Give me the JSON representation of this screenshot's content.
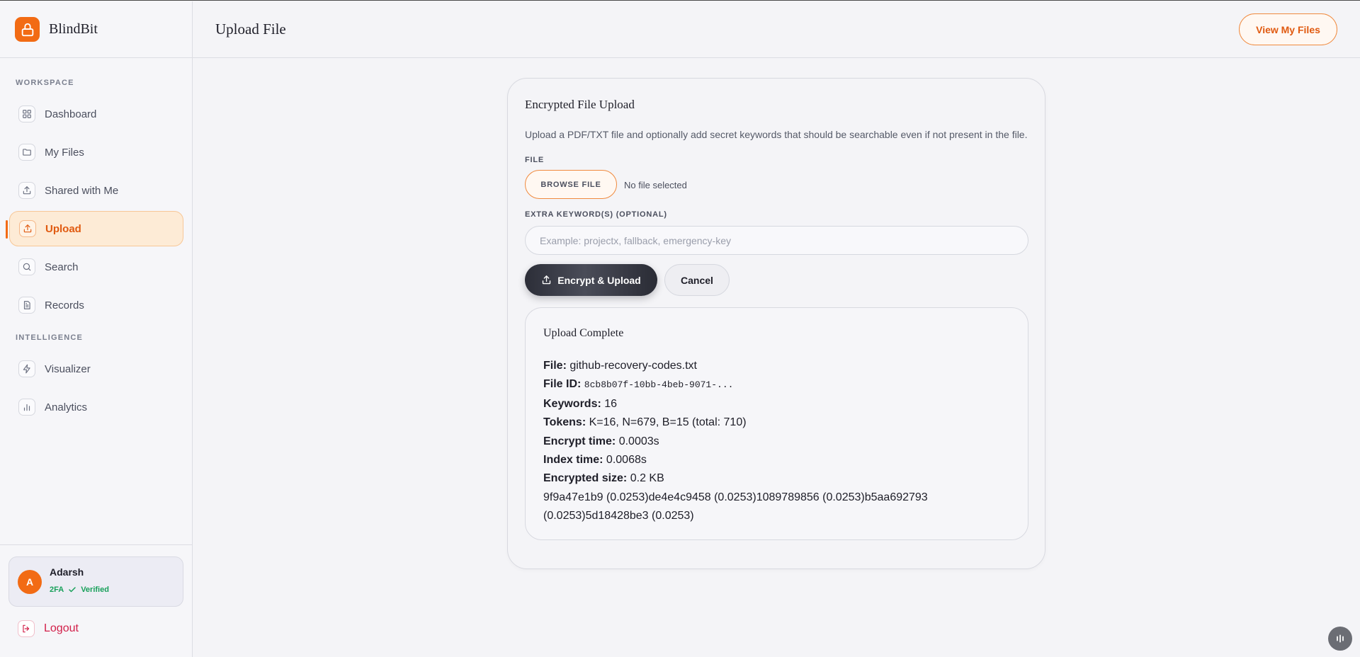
{
  "app": {
    "name": "BlindBit"
  },
  "sidebar": {
    "sections": {
      "workspace": "WORKSPACE",
      "intelligence": "INTELLIGENCE"
    },
    "items": [
      {
        "label": "Dashboard",
        "icon": "grid-icon"
      },
      {
        "label": "My Files",
        "icon": "folder-icon"
      },
      {
        "label": "Shared with Me",
        "icon": "share-icon"
      },
      {
        "label": "Upload",
        "icon": "upload-icon",
        "active": true
      },
      {
        "label": "Search",
        "icon": "search-icon"
      },
      {
        "label": "Records",
        "icon": "document-icon"
      },
      {
        "label": "Visualizer",
        "icon": "bolt-icon"
      },
      {
        "label": "Analytics",
        "icon": "bar-chart-icon"
      }
    ],
    "user": {
      "initial": "A",
      "name": "Adarsh",
      "twofa": "2FA",
      "verified": "Verified"
    },
    "logout": "Logout"
  },
  "header": {
    "title": "Upload File",
    "view_files": "View My Files"
  },
  "upload": {
    "title": "Encrypted File Upload",
    "description": "Upload a PDF/TXT file and optionally add secret keywords that should be searchable even if not present in the file.",
    "file_label": "FILE",
    "browse": "BROWSE FILE",
    "no_file": "No file selected",
    "keywords_label": "EXTRA KEYWORD(S) (OPTIONAL)",
    "keywords_placeholder": "Example: projectx, fallback, emergency-key",
    "keywords_value": "",
    "encrypt": "Encrypt & Upload",
    "cancel": "Cancel"
  },
  "result": {
    "title": "Upload Complete",
    "file_k": "File:",
    "file_v": "github-recovery-codes.txt",
    "id_k": "File ID:",
    "id_v": "8cb8b07f-10bb-4beb-9071-...",
    "keywords_k": "Keywords:",
    "keywords_v": "16",
    "tokens_k": "Tokens:",
    "tokens_v": "K=16, N=679, B=15 (total: 710)",
    "encrypt_k": "Encrypt time:",
    "encrypt_v": "0.0003s",
    "index_k": "Index time:",
    "index_v": "0.0068s",
    "size_k": "Encrypted size:",
    "size_v": "0.2 KB",
    "hashes": "9f9a47e1b9 (0.0253)de4e4c9458 (0.0253)1089789856 (0.0253)b5aa692793 (0.0253)5d18428be3 (0.0253)"
  },
  "colors": {
    "accent": "#f26b14",
    "verified": "#18a05a",
    "logout": "#d2204a"
  }
}
